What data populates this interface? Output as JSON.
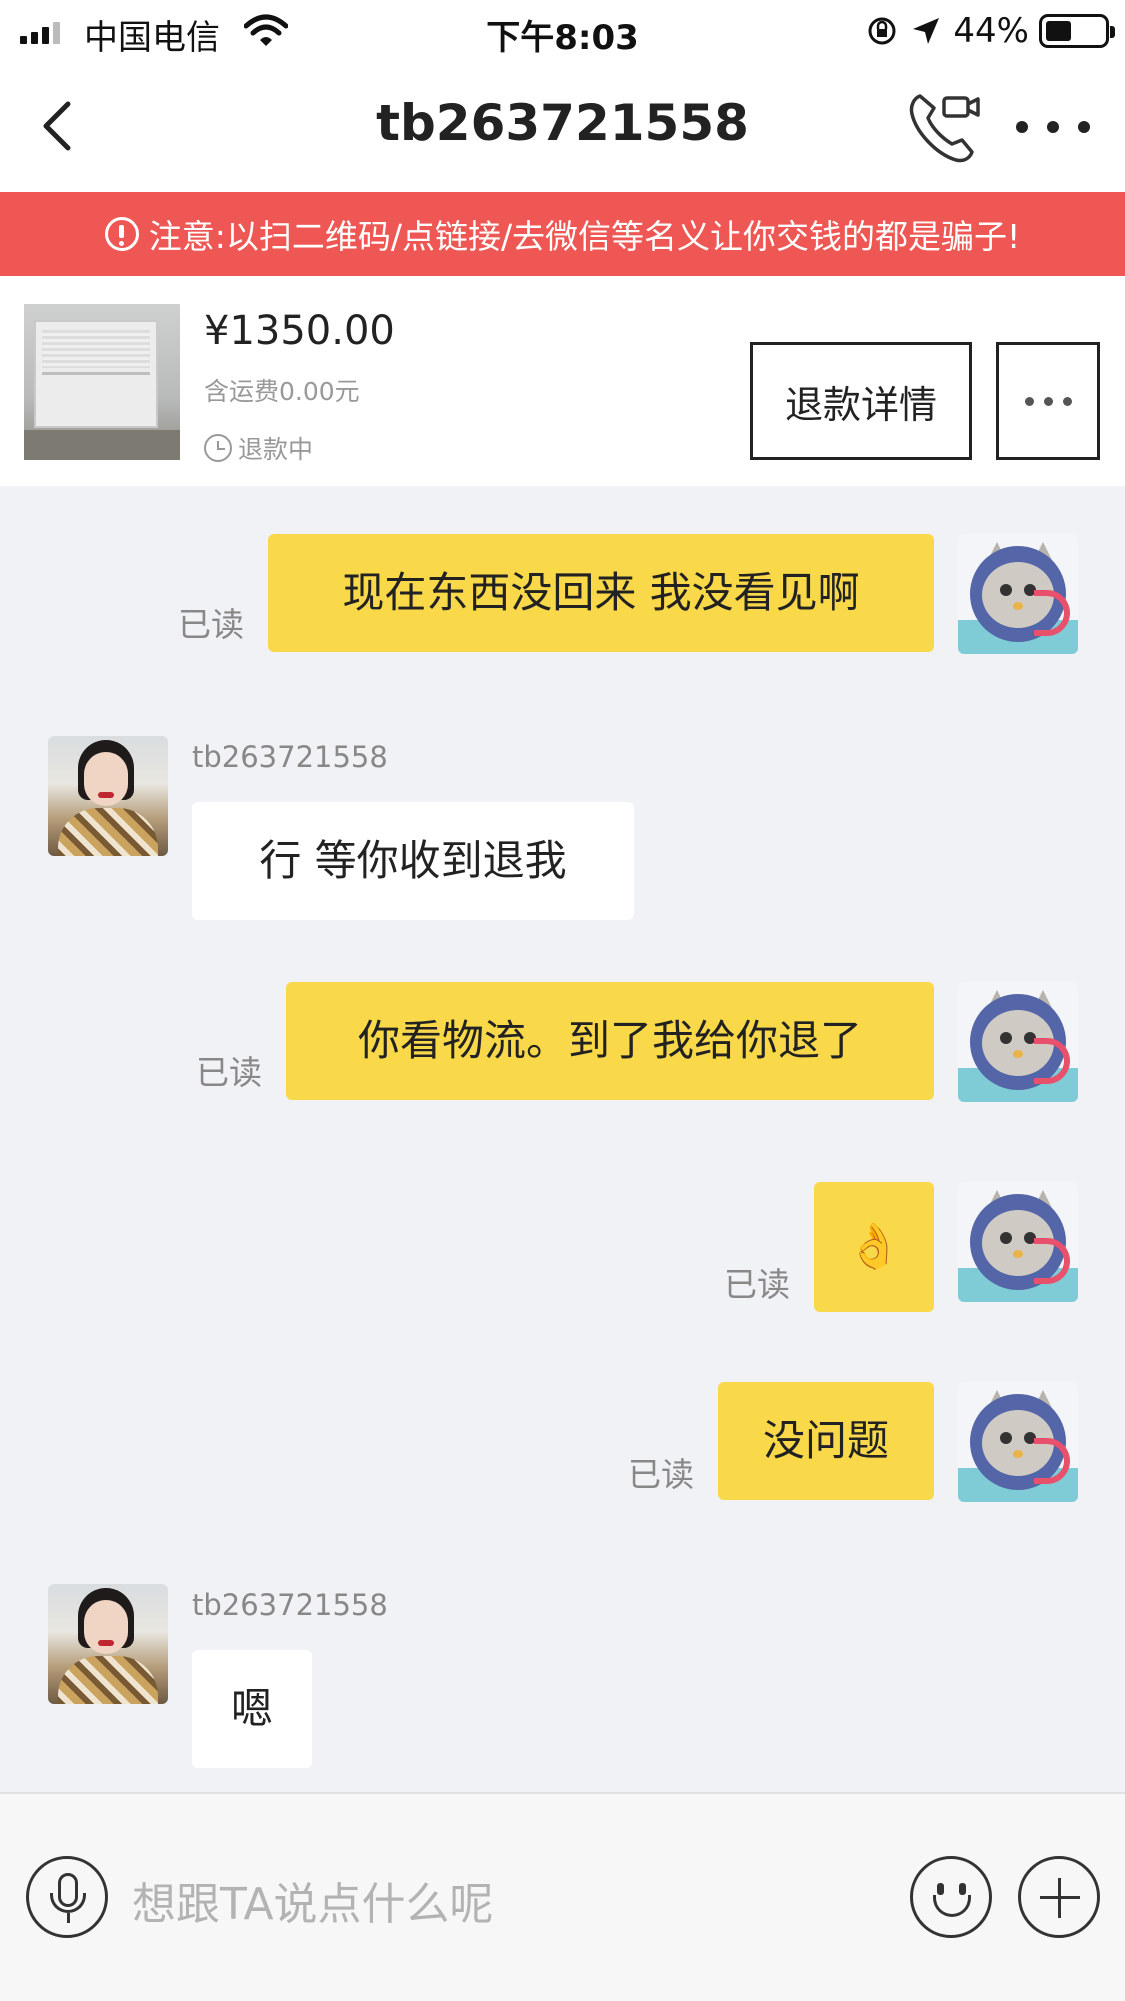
{
  "status_bar": {
    "carrier": "中国电信",
    "time": "下午8:03",
    "battery_percent": "44%",
    "battery_level": 0.44,
    "icons": [
      "signal-icon",
      "wifi-icon",
      "orientation-lock-icon",
      "location-arrow-icon",
      "battery-icon"
    ]
  },
  "nav": {
    "title": "tb263721558",
    "icons": [
      "back-chevron-icon",
      "video-call-icon",
      "more-dots-icon"
    ]
  },
  "warning": {
    "text": "注意:以扫二维码/点链接/去微信等名义让你交钱的都是骗子!",
    "icon": "alert-circle-icon",
    "color": "#ee5753"
  },
  "product": {
    "price": "¥1350.00",
    "shipping": "含运费0.00元",
    "status": "退款中",
    "refund_details_button": "退款详情",
    "more_button_icon": "more-dots-icon"
  },
  "messages": [
    {
      "from": "me",
      "text": "现在东西没回来 我没看见啊",
      "read": "已读"
    },
    {
      "from": "them",
      "sender": "tb263721558",
      "text": "行  等你收到退我"
    },
    {
      "from": "me",
      "text": "你看物流。到了我给你退了",
      "read": "已读"
    },
    {
      "from": "me",
      "text": "👌",
      "read": "已读"
    },
    {
      "from": "me",
      "text": "没问题",
      "read": "已读"
    },
    {
      "from": "them",
      "sender": "tb263721558",
      "text": "嗯"
    }
  ],
  "input": {
    "placeholder": "想跟TA说点什么呢",
    "icons": [
      "microphone-icon",
      "emoji-icon",
      "plus-icon"
    ]
  },
  "colors": {
    "my_bubble": "#f9d949",
    "their_bubble": "#ffffff",
    "chat_background": "#f0f2f6"
  }
}
